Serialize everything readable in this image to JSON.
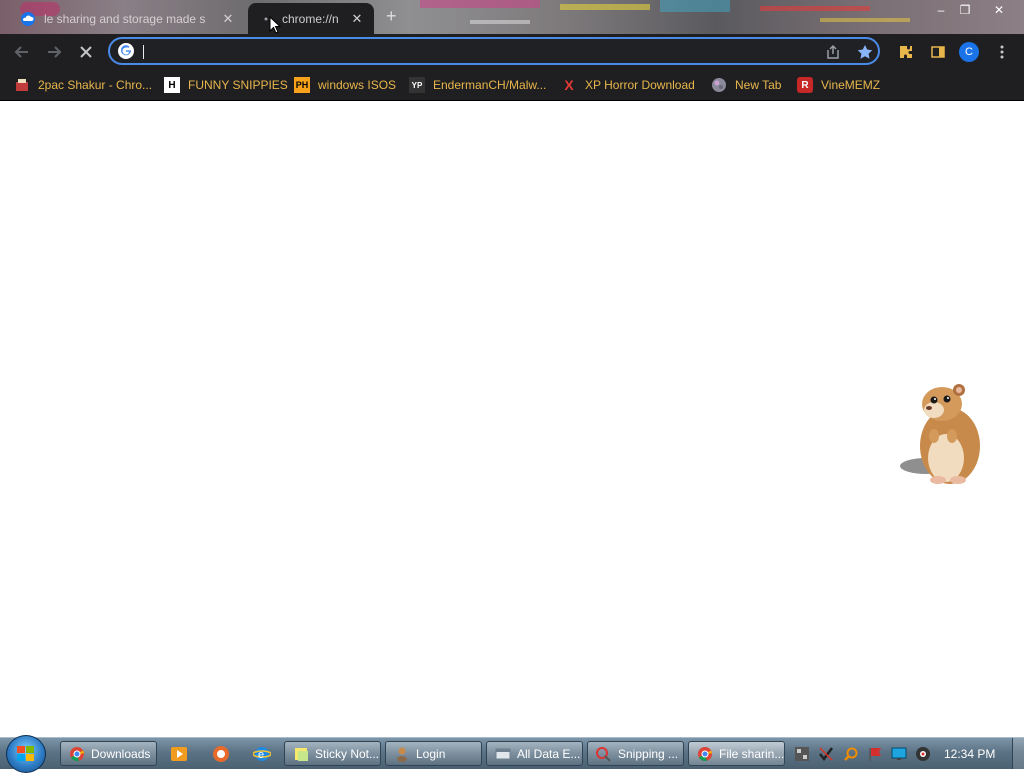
{
  "browser": {
    "tabs": [
      {
        "title": "le sharing and storage made s",
        "active": false
      },
      {
        "title": "chrome://n",
        "active": true
      }
    ],
    "new_tab_symbol": "+",
    "window_controls": {
      "minimize": "–",
      "restore": "❐",
      "close": "✕"
    },
    "omnibox": {
      "value": "",
      "placeholder": ""
    },
    "profile_initial": "C",
    "accent_color": "#4b8be8"
  },
  "bookmarks": [
    {
      "label": "2pac Shakur - Chro...",
      "icon": "2pac-icon"
    },
    {
      "label": "FUNNY SNIPPIES",
      "icon": "h-icon"
    },
    {
      "label": "windows ISOS",
      "icon": "ph-icon"
    },
    {
      "label": "EndermanCH/Malw...",
      "icon": "yp-icon"
    },
    {
      "label": "XP Horror Download",
      "icon": "x-icon"
    },
    {
      "label": "New Tab",
      "icon": "globe-icon"
    },
    {
      "label": "VineMEMZ",
      "icon": "r-icon"
    }
  ],
  "bookmark_badges": {
    "h": "H",
    "ph": "PH",
    "yp": "YP",
    "x": "X",
    "r": "R"
  },
  "taskbar": {
    "buttons": [
      {
        "label": "Downloads",
        "icon": "chrome-icon"
      },
      {
        "label": "Sticky Not...",
        "icon": "sticky-notes-icon"
      },
      {
        "label": "Login",
        "icon": "login-icon"
      },
      {
        "label": "All Data E...",
        "icon": "window-icon"
      },
      {
        "label": "Snipping ...",
        "icon": "snipping-icon"
      },
      {
        "label": "File sharin...",
        "icon": "chrome-icon"
      }
    ],
    "clock": "12:34 PM"
  }
}
